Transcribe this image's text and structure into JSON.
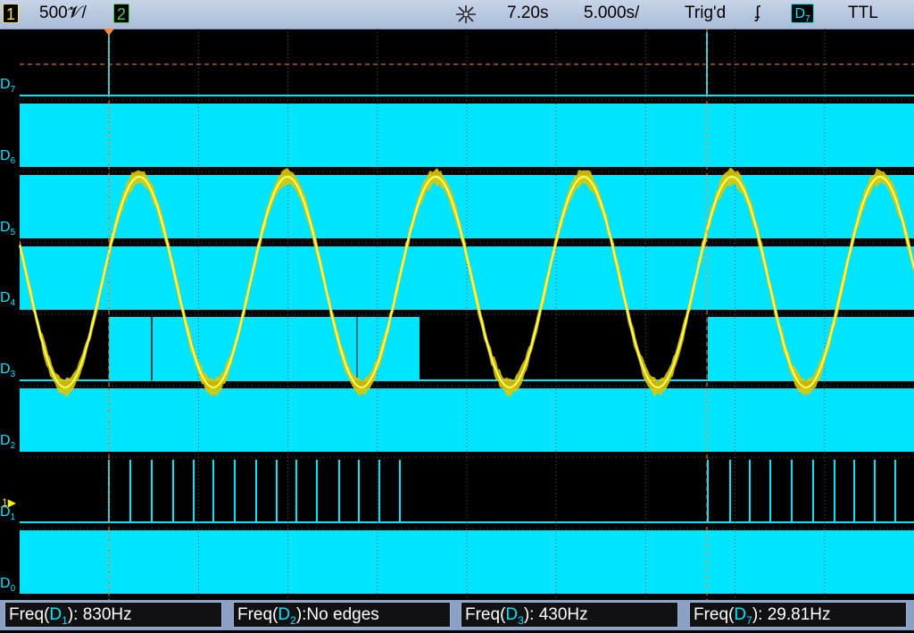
{
  "topbar": {
    "ch1_num": "1",
    "ch1_scale": "500𝓥/",
    "ch2_num": "2",
    "acq_icon": "sparkle-icon",
    "delay": "7.20s",
    "timebase": "5.000s/",
    "trig_status": "Trig'd",
    "trig_edge": "ʄ",
    "trig_src_letter": "D",
    "trig_src_sub": "7",
    "trig_level": "TTL"
  },
  "lanes": [
    {
      "prefix": "D",
      "sub": "7"
    },
    {
      "prefix": "D",
      "sub": "6"
    },
    {
      "prefix": "D",
      "sub": "5"
    },
    {
      "prefix": "D",
      "sub": "4"
    },
    {
      "prefix": "D",
      "sub": "3"
    },
    {
      "prefix": "D",
      "sub": "2"
    },
    {
      "prefix": "D",
      "sub": "1"
    },
    {
      "prefix": "D",
      "sub": "0"
    }
  ],
  "analog_marker": "1",
  "measurements": [
    {
      "prefix": "Freq(",
      "src": "D",
      "sub": "1",
      "suffix": "): 830Hz"
    },
    {
      "prefix": "Freq(",
      "src": "D",
      "sub": "2",
      "suffix": "):No edges"
    },
    {
      "prefix": "Freq(",
      "src": "D",
      "sub": "3",
      "suffix": "): 430Hz"
    },
    {
      "prefix": "Freq(",
      "src": "D",
      "sub": "7",
      "suffix": "): 29.81Hz"
    }
  ],
  "colors": {
    "digital": "#00e5ff",
    "analog": "#ffee00",
    "ch1_badge": "#f5e14a",
    "ch2_badge": "#4ccc4c",
    "cursor": "#ff8a3c"
  }
}
